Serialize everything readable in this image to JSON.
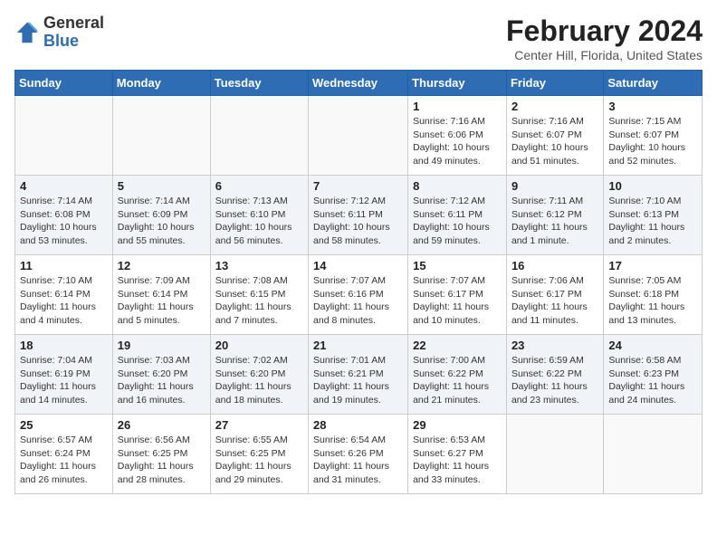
{
  "logo": {
    "general": "General",
    "blue": "Blue"
  },
  "title": "February 2024",
  "subtitle": "Center Hill, Florida, United States",
  "days_of_week": [
    "Sunday",
    "Monday",
    "Tuesday",
    "Wednesday",
    "Thursday",
    "Friday",
    "Saturday"
  ],
  "weeks": [
    [
      {
        "day": "",
        "info": ""
      },
      {
        "day": "",
        "info": ""
      },
      {
        "day": "",
        "info": ""
      },
      {
        "day": "",
        "info": ""
      },
      {
        "day": "1",
        "info": "Sunrise: 7:16 AM\nSunset: 6:06 PM\nDaylight: 10 hours\nand 49 minutes."
      },
      {
        "day": "2",
        "info": "Sunrise: 7:16 AM\nSunset: 6:07 PM\nDaylight: 10 hours\nand 51 minutes."
      },
      {
        "day": "3",
        "info": "Sunrise: 7:15 AM\nSunset: 6:07 PM\nDaylight: 10 hours\nand 52 minutes."
      }
    ],
    [
      {
        "day": "4",
        "info": "Sunrise: 7:14 AM\nSunset: 6:08 PM\nDaylight: 10 hours\nand 53 minutes."
      },
      {
        "day": "5",
        "info": "Sunrise: 7:14 AM\nSunset: 6:09 PM\nDaylight: 10 hours\nand 55 minutes."
      },
      {
        "day": "6",
        "info": "Sunrise: 7:13 AM\nSunset: 6:10 PM\nDaylight: 10 hours\nand 56 minutes."
      },
      {
        "day": "7",
        "info": "Sunrise: 7:12 AM\nSunset: 6:11 PM\nDaylight: 10 hours\nand 58 minutes."
      },
      {
        "day": "8",
        "info": "Sunrise: 7:12 AM\nSunset: 6:11 PM\nDaylight: 10 hours\nand 59 minutes."
      },
      {
        "day": "9",
        "info": "Sunrise: 7:11 AM\nSunset: 6:12 PM\nDaylight: 11 hours\nand 1 minute."
      },
      {
        "day": "10",
        "info": "Sunrise: 7:10 AM\nSunset: 6:13 PM\nDaylight: 11 hours\nand 2 minutes."
      }
    ],
    [
      {
        "day": "11",
        "info": "Sunrise: 7:10 AM\nSunset: 6:14 PM\nDaylight: 11 hours\nand 4 minutes."
      },
      {
        "day": "12",
        "info": "Sunrise: 7:09 AM\nSunset: 6:14 PM\nDaylight: 11 hours\nand 5 minutes."
      },
      {
        "day": "13",
        "info": "Sunrise: 7:08 AM\nSunset: 6:15 PM\nDaylight: 11 hours\nand 7 minutes."
      },
      {
        "day": "14",
        "info": "Sunrise: 7:07 AM\nSunset: 6:16 PM\nDaylight: 11 hours\nand 8 minutes."
      },
      {
        "day": "15",
        "info": "Sunrise: 7:07 AM\nSunset: 6:17 PM\nDaylight: 11 hours\nand 10 minutes."
      },
      {
        "day": "16",
        "info": "Sunrise: 7:06 AM\nSunset: 6:17 PM\nDaylight: 11 hours\nand 11 minutes."
      },
      {
        "day": "17",
        "info": "Sunrise: 7:05 AM\nSunset: 6:18 PM\nDaylight: 11 hours\nand 13 minutes."
      }
    ],
    [
      {
        "day": "18",
        "info": "Sunrise: 7:04 AM\nSunset: 6:19 PM\nDaylight: 11 hours\nand 14 minutes."
      },
      {
        "day": "19",
        "info": "Sunrise: 7:03 AM\nSunset: 6:20 PM\nDaylight: 11 hours\nand 16 minutes."
      },
      {
        "day": "20",
        "info": "Sunrise: 7:02 AM\nSunset: 6:20 PM\nDaylight: 11 hours\nand 18 minutes."
      },
      {
        "day": "21",
        "info": "Sunrise: 7:01 AM\nSunset: 6:21 PM\nDaylight: 11 hours\nand 19 minutes."
      },
      {
        "day": "22",
        "info": "Sunrise: 7:00 AM\nSunset: 6:22 PM\nDaylight: 11 hours\nand 21 minutes."
      },
      {
        "day": "23",
        "info": "Sunrise: 6:59 AM\nSunset: 6:22 PM\nDaylight: 11 hours\nand 23 minutes."
      },
      {
        "day": "24",
        "info": "Sunrise: 6:58 AM\nSunset: 6:23 PM\nDaylight: 11 hours\nand 24 minutes."
      }
    ],
    [
      {
        "day": "25",
        "info": "Sunrise: 6:57 AM\nSunset: 6:24 PM\nDaylight: 11 hours\nand 26 minutes."
      },
      {
        "day": "26",
        "info": "Sunrise: 6:56 AM\nSunset: 6:25 PM\nDaylight: 11 hours\nand 28 minutes."
      },
      {
        "day": "27",
        "info": "Sunrise: 6:55 AM\nSunset: 6:25 PM\nDaylight: 11 hours\nand 29 minutes."
      },
      {
        "day": "28",
        "info": "Sunrise: 6:54 AM\nSunset: 6:26 PM\nDaylight: 11 hours\nand 31 minutes."
      },
      {
        "day": "29",
        "info": "Sunrise: 6:53 AM\nSunset: 6:27 PM\nDaylight: 11 hours\nand 33 minutes."
      },
      {
        "day": "",
        "info": ""
      },
      {
        "day": "",
        "info": ""
      }
    ]
  ]
}
